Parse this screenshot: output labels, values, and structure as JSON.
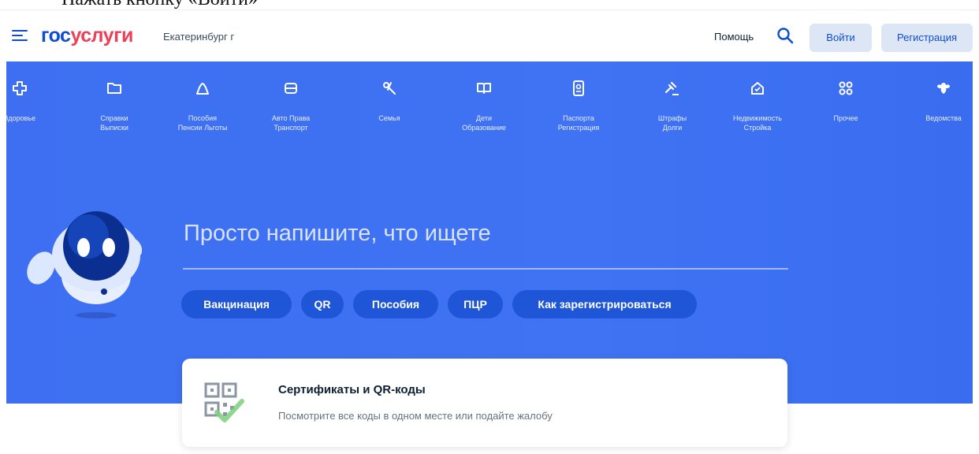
{
  "caption": "Нажать кнопку «Войти»",
  "header": {
    "logo_part1": "гос",
    "logo_part2": "услуги",
    "city": "Екатеринбург г",
    "help": "Помощь",
    "login": "Войти",
    "register": "Регистрация",
    "icons": [
      "menu-icon",
      "search-icon"
    ]
  },
  "categories": [
    {
      "label": "Здоровье",
      "icon": "health-cross-icon"
    },
    {
      "label": "Справки\nВыписки",
      "icon": "folder-icon"
    },
    {
      "label": "Пособия\nПенсии Льготы",
      "icon": "benefits-icon"
    },
    {
      "label": "Авто Права\nТранспорт",
      "icon": "car-icon"
    },
    {
      "label": "Семья",
      "icon": "family-icon"
    },
    {
      "label": "Дети\nОбразование",
      "icon": "book-icon"
    },
    {
      "label": "Паспорта\nРегистрация",
      "icon": "passport-icon"
    },
    {
      "label": "Штрафы\nДолги",
      "icon": "gavel-icon"
    },
    {
      "label": "Недвижимость\nСтройка",
      "icon": "house-icon"
    },
    {
      "label": "Прочее",
      "icon": "grid-icon"
    },
    {
      "label": "Ведомства",
      "icon": "emblem-icon"
    }
  ],
  "search": {
    "prompt": "Просто напишите, что ищете"
  },
  "chips": [
    {
      "label": "Вакцинация"
    },
    {
      "label": "QR"
    },
    {
      "label": "Пособия"
    },
    {
      "label": "ПЦР"
    },
    {
      "label": "Как зарегистрироваться"
    }
  ],
  "card": {
    "title": "Сертификаты и QR-коды",
    "subtitle": "Посмотрите все коды в одном месте или подайте жалобу",
    "icon": "qr-certificate-icon"
  },
  "colors": {
    "brand_blue": "#0d4cd3",
    "brand_red": "#ee3f58",
    "hero_blue": "#3f73f3",
    "chip_blue": "#1f56d7"
  }
}
